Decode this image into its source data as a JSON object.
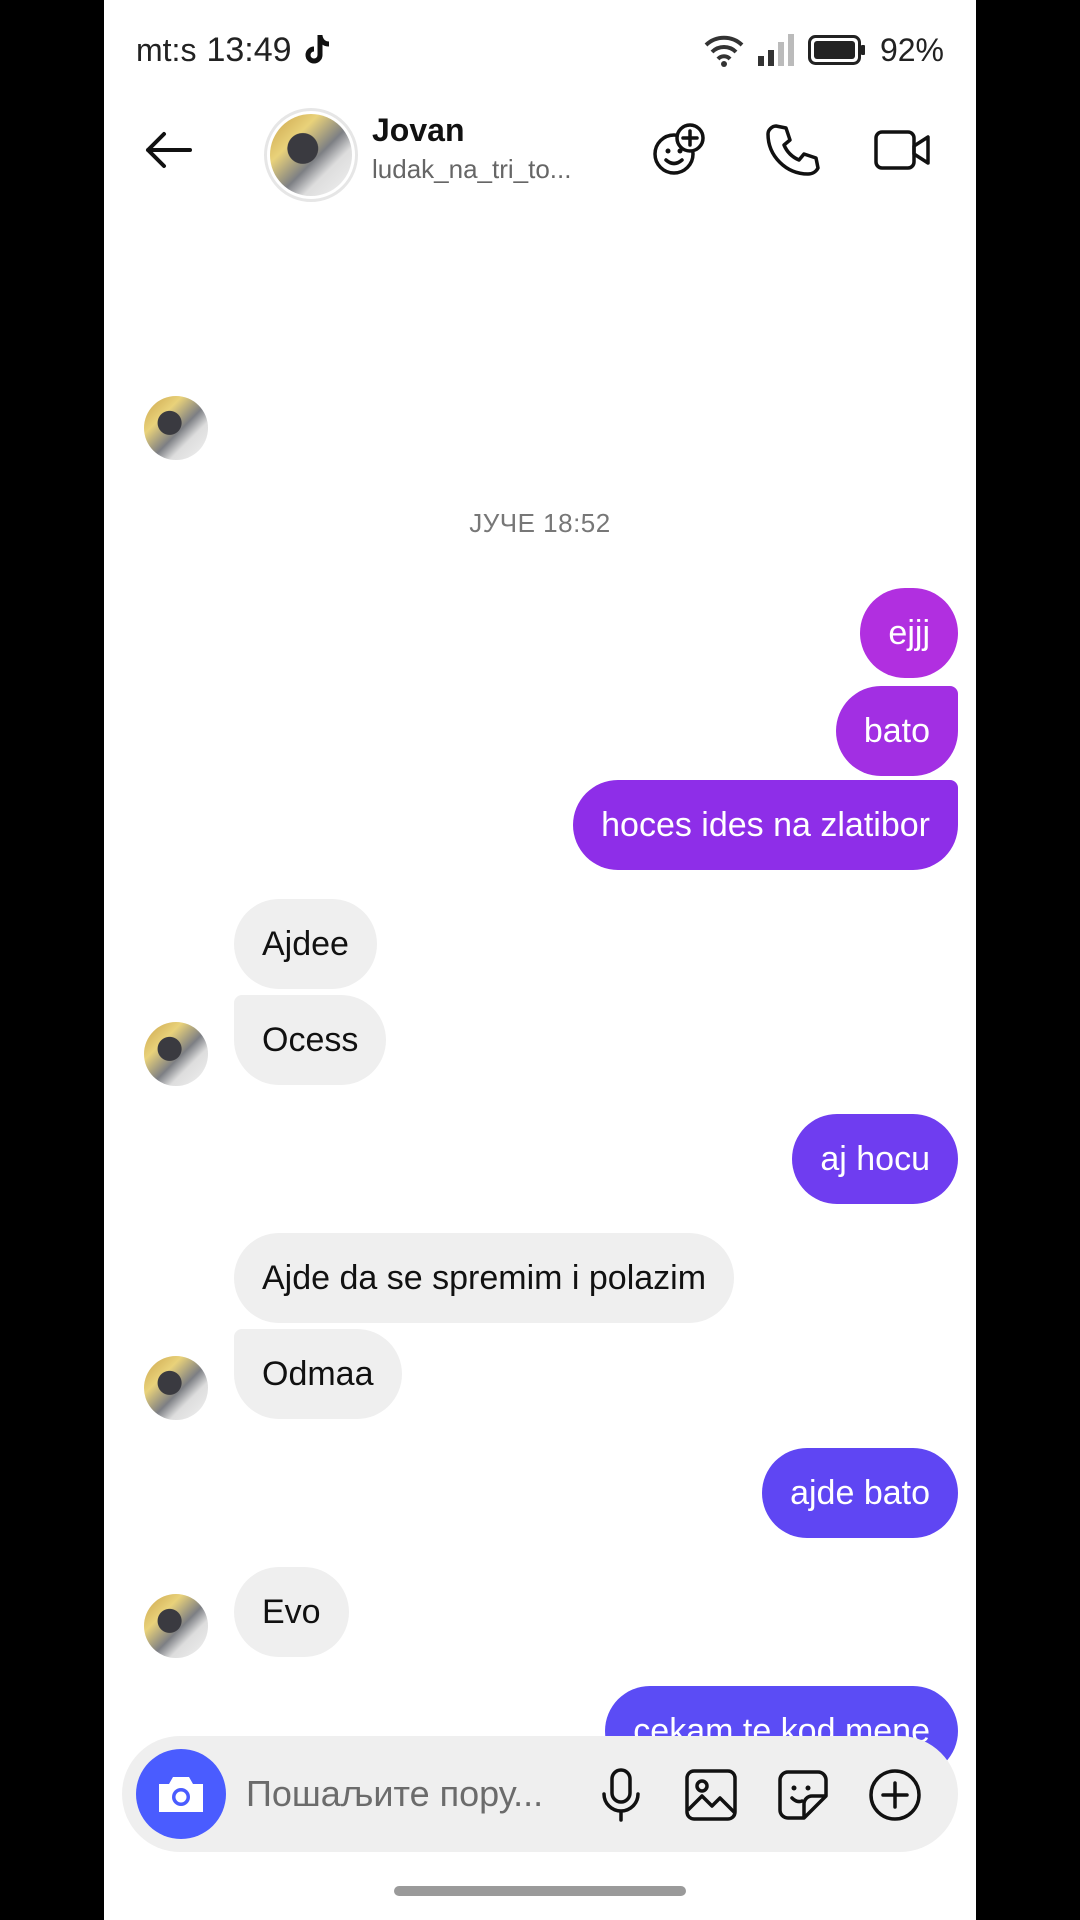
{
  "status_bar": {
    "carrier": "mt:s",
    "time": "13:49",
    "battery_percent": "92%"
  },
  "header": {
    "name": "Jovan",
    "username": "ludak_na_tri_to..."
  },
  "chat": {
    "day_stamp": "ЈУЧЕ 18:52",
    "messages": [
      {
        "from": "me",
        "text": "ejjj"
      },
      {
        "from": "me",
        "text": "bato"
      },
      {
        "from": "me",
        "text": "hoces ides na zlatibor"
      },
      {
        "from": "them",
        "text": "Ajdee"
      },
      {
        "from": "them",
        "text": "Ocess"
      },
      {
        "from": "me",
        "text": "aj hocu"
      },
      {
        "from": "them",
        "text": "Ajde da se spremim i polazim"
      },
      {
        "from": "them",
        "text": "Odmaa"
      },
      {
        "from": "me",
        "text": "ajde bato"
      },
      {
        "from": "them",
        "text": "Evo"
      },
      {
        "from": "me",
        "text": "cekam te kod mene"
      }
    ]
  },
  "composer": {
    "placeholder": "Пошаљите пору..."
  },
  "colors": {
    "bubble_gradient": [
      "#b12fe0",
      "#8e2ee8",
      "#6f3df0",
      "#5b4cf5"
    ],
    "incoming_bubble": "#efefef",
    "camera_button": "#4a5cff"
  },
  "icons": [
    "back-arrow-icon",
    "add-people-icon",
    "phone-icon",
    "video-icon",
    "camera-icon",
    "microphone-icon",
    "gallery-icon",
    "sticker-icon",
    "plus-circle-icon",
    "wifi-icon",
    "signal-icon",
    "battery-icon",
    "tiktok-icon"
  ]
}
